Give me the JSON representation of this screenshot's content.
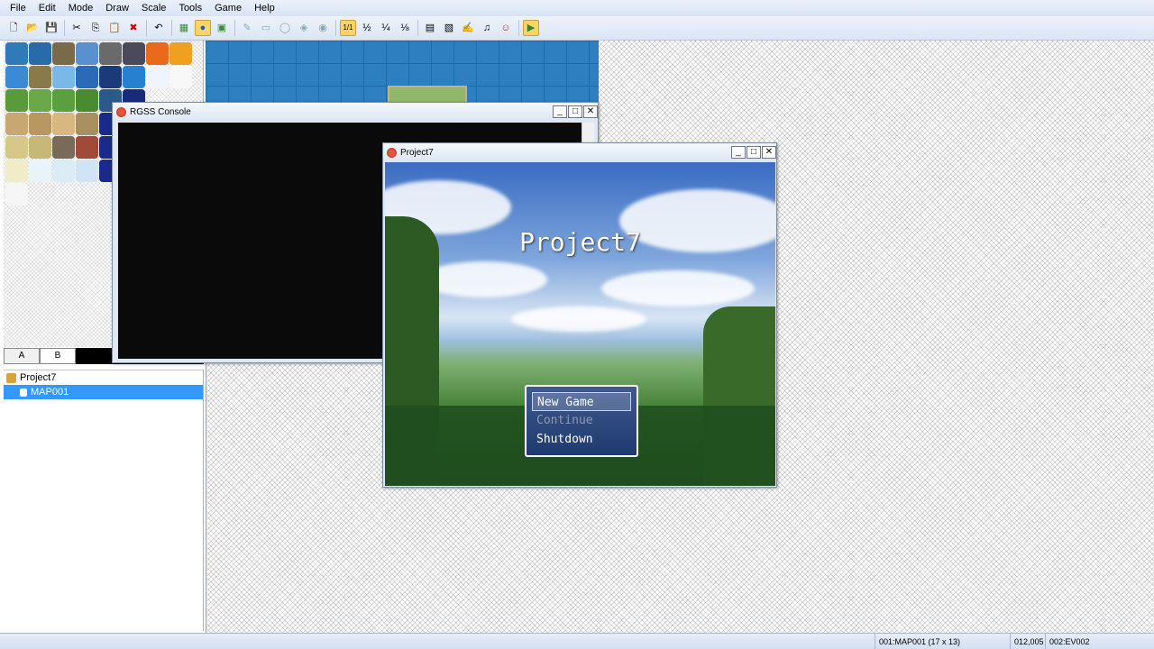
{
  "menubar": {
    "items": [
      "File",
      "Edit",
      "Mode",
      "Draw",
      "Scale",
      "Tools",
      "Game",
      "Help"
    ]
  },
  "toolbar": {
    "buttons": [
      {
        "icon": "new-project-icon",
        "glyph": "🗋"
      },
      {
        "icon": "open-project-icon",
        "glyph": "📂"
      },
      {
        "icon": "save-project-icon",
        "glyph": "💾"
      },
      {
        "icon": "cut-icon",
        "glyph": "✂"
      },
      {
        "icon": "copy-icon",
        "glyph": "⎘"
      },
      {
        "icon": "paste-icon",
        "glyph": "📋"
      },
      {
        "icon": "delete-icon",
        "glyph": "✖"
      },
      {
        "icon": "undo-icon",
        "glyph": "↶"
      },
      {
        "icon": "layer-map-icon",
        "glyph": "▦"
      },
      {
        "icon": "layer-event-icon",
        "glyph": "●"
      },
      {
        "icon": "layer-region-icon",
        "glyph": "▣"
      },
      {
        "icon": "pencil-icon",
        "glyph": "✎"
      },
      {
        "icon": "rectangle-icon",
        "glyph": "▭"
      },
      {
        "icon": "ellipse-icon",
        "glyph": "◯"
      },
      {
        "icon": "fill-icon",
        "glyph": "◈"
      },
      {
        "icon": "shadow-pen-icon",
        "glyph": "◉"
      },
      {
        "icon": "zoom-1-1-icon",
        "glyph": "1/1"
      },
      {
        "icon": "zoom-1-2-icon",
        "glyph": "½"
      },
      {
        "icon": "zoom-1-4-icon",
        "glyph": "¼"
      },
      {
        "icon": "zoom-1-8-icon",
        "glyph": "⅛"
      },
      {
        "icon": "database-icon",
        "glyph": "▤"
      },
      {
        "icon": "resource-manager-icon",
        "glyph": "▧"
      },
      {
        "icon": "script-editor-icon",
        "glyph": "✍"
      },
      {
        "icon": "sound-test-icon",
        "glyph": "♫"
      },
      {
        "icon": "character-generator-icon",
        "glyph": "☺"
      },
      {
        "icon": "playtest-icon",
        "glyph": "▶"
      }
    ]
  },
  "tileset": {
    "tabs": [
      "A",
      "B"
    ],
    "selected_tab": "B"
  },
  "tree": {
    "project": "Project7",
    "maps": [
      "MAP001"
    ]
  },
  "console": {
    "title": "RGSS Console"
  },
  "game": {
    "window_title": "Project7",
    "title": "Project7",
    "menu": [
      "New Game",
      "Continue",
      "Shutdown"
    ],
    "selected": "New Game",
    "disabled": [
      "Continue"
    ]
  },
  "statusbar": {
    "map_info": "001:MAP001 (17 x 13)",
    "coords": "012,005",
    "event": "002:EV002"
  },
  "window_buttons": {
    "minimize": "_",
    "maximize": "□",
    "close": "✕"
  }
}
